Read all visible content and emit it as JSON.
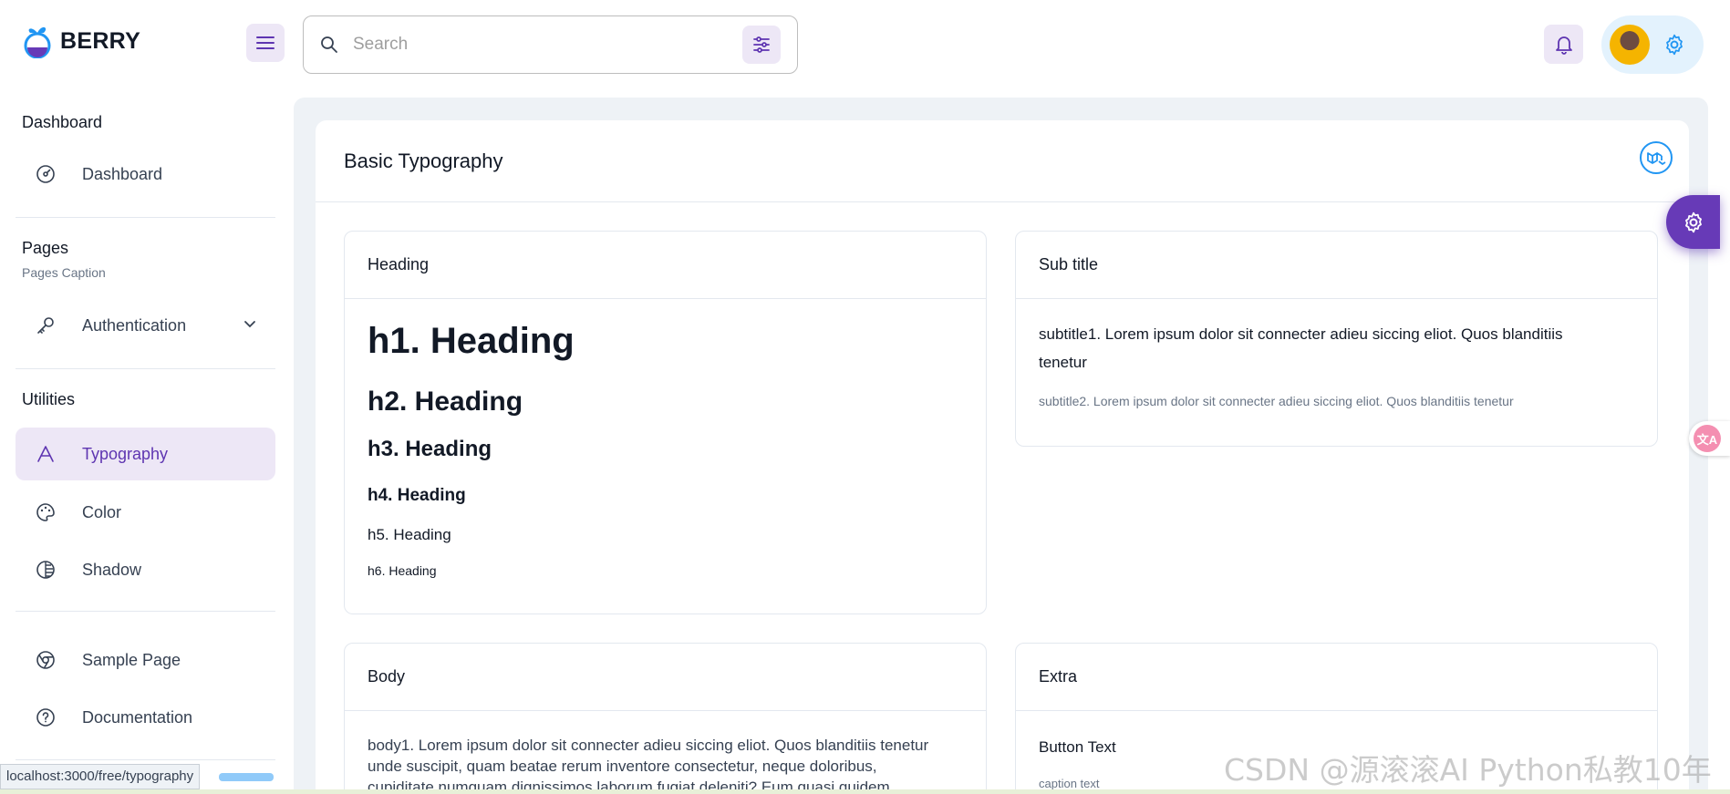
{
  "brand": {
    "name": "BERRY"
  },
  "header": {
    "search_placeholder": "Search",
    "icons": [
      "menu-icon",
      "search-icon",
      "filter-icon",
      "bell-icon",
      "avatar",
      "settings-icon"
    ]
  },
  "sidebar": {
    "groups": [
      {
        "title": "Dashboard",
        "items": [
          {
            "label": "Dashboard",
            "icon": "dashboard-icon"
          }
        ]
      },
      {
        "title": "Pages",
        "caption": "Pages Caption",
        "items": [
          {
            "label": "Authentication",
            "icon": "key-icon",
            "expandable": true
          }
        ]
      },
      {
        "title": "Utilities",
        "items": [
          {
            "label": "Typography",
            "icon": "typography-icon",
            "active": true
          },
          {
            "label": "Color",
            "icon": "palette-icon"
          },
          {
            "label": "Shadow",
            "icon": "shadow-icon"
          }
        ]
      },
      {
        "title": "",
        "items": [
          {
            "label": "Sample Page",
            "icon": "brand-chrome-icon"
          },
          {
            "label": "Documentation",
            "icon": "help-icon"
          }
        ]
      }
    ],
    "status_url": "localhost:3000/free/typography"
  },
  "main": {
    "title": "Basic Typography",
    "cards": {
      "heading": {
        "title": "Heading",
        "h1": "h1. Heading",
        "h2": "h2. Heading",
        "h3": "h3. Heading",
        "h4": "h4. Heading",
        "h5": "h5. Heading",
        "h6": "h6. Heading"
      },
      "subtitle": {
        "title": "Sub title",
        "subtitle1_line1": "subtitle1. Lorem ipsum dolor sit connecter adieu siccing eliot. Quos blanditiis",
        "subtitle1_line2": "tenetur",
        "subtitle2": "subtitle2. Lorem ipsum dolor sit connecter adieu siccing eliot. Quos blanditiis tenetur"
      },
      "body": {
        "title": "Body",
        "line1": "body1. Lorem ipsum dolor sit connecter adieu siccing eliot. Quos blanditiis tenetur",
        "line2": "unde suscipit, quam beatae rerum inventore consectetur, neque doloribus,",
        "line3": "cupiditate numquam dignissimos laborum fugiat deleniti? Eum quasi quidem"
      },
      "extra": {
        "title": "Extra",
        "button_text": "Button Text",
        "caption": "caption text"
      }
    }
  },
  "colors": {
    "primary": "#5e35b1",
    "primary_light": "#ede7f6",
    "secondary": "#2196f3",
    "bg": "#eef2f6"
  },
  "watermark": "CSDN @源滚滚AI Python私教10年"
}
